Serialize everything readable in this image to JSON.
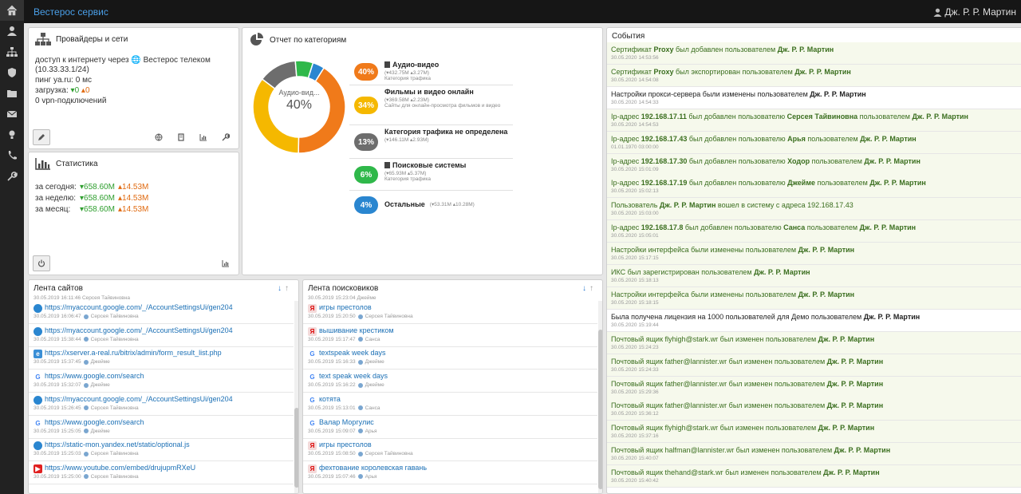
{
  "app": {
    "title": "Вестерос сервис",
    "user": "Дж. Р. Р. Мартин"
  },
  "sidebar": [
    {
      "icon": "home-icon",
      "active": true
    },
    {
      "icon": "user-icon"
    },
    {
      "icon": "sitemap-icon"
    },
    {
      "icon": "shield-icon"
    },
    {
      "icon": "folder-icon"
    },
    {
      "icon": "envelope-icon"
    },
    {
      "icon": "lightbulb-icon"
    },
    {
      "icon": "phone-icon"
    },
    {
      "icon": "wrench-icon"
    }
  ],
  "providers": {
    "title": "Провайдеры и сети",
    "access_prefix": "доступ к интернету через",
    "provider": "Вестерос телеком",
    "ip": "(10.33.33.1/24)",
    "ping": "пинг ya.ru: 0 мс",
    "load_label": "загрузка:",
    "load_down": "▾0",
    "load_up": "▴0",
    "vpn": "0 vpn-подключений"
  },
  "stats": {
    "title": "Статистика",
    "rows": [
      {
        "label": "за сегодня:",
        "down": "▾658.60M",
        "up": "▴14.53M"
      },
      {
        "label": "за неделю:",
        "down": "▾658.60M",
        "up": "▴14.53M"
      },
      {
        "label": "за месяц:",
        "down": "▾658.60M",
        "up": "▴14.53M"
      }
    ]
  },
  "categories": {
    "title": "Отчет по категориям",
    "donut_label": "Аудио-вид...",
    "donut_value": "40%",
    "items": [
      {
        "pct": "40%",
        "name": "Аудио-видео",
        "meta": "(▾432.75M ▴3.27M)",
        "sub": "Категория трафика",
        "color": "#f07a1a"
      },
      {
        "pct": "34%",
        "name": "Фильмы и видео онлайн",
        "meta": "(▾369.58M ▴2.23M)",
        "sub": "Сайты для онлайн-просмотра фильмов и видео",
        "color": "#f5b800"
      },
      {
        "pct": "13%",
        "name": "Категория трафика не определена",
        "meta": "(▾146.11M ▴2.93M)",
        "sub": "",
        "color": "#6d6d6d"
      },
      {
        "pct": "6%",
        "name": "Поисковые системы",
        "meta": "(▾65.93M ▴5.37M)",
        "sub": "Категория трафика",
        "color": "#2fb84a"
      },
      {
        "pct": "4%",
        "name": "Остальные",
        "meta": "(▾53.31M ▴10.28M)",
        "sub": "",
        "color": "#2a86d0"
      }
    ],
    "chart_data": {
      "type": "pie",
      "categories": [
        "Аудио-видео",
        "Фильмы и видео онлайн",
        "Категория трафика не определена",
        "Поисковые системы",
        "Остальные"
      ],
      "values": [
        40,
        34,
        13,
        6,
        4
      ],
      "colors": [
        "#f07a1a",
        "#f5b800",
        "#6d6d6d",
        "#2fb84a",
        "#2a86d0"
      ]
    }
  },
  "events": {
    "title": "События",
    "items": [
      {
        "t": [
          "Сертификат ",
          "Proxy",
          " был добавлен пользователем ",
          "Дж. Р. Р. Мартин"
        ],
        "d": "30.05.2020 14:53:56",
        "g": true
      },
      {
        "t": [
          "Сертификат ",
          "Proxy",
          " был экспортирован пользователем ",
          "Дж. Р. Р. Мартин"
        ],
        "d": "30.05.2020 14:54:08",
        "g": true
      },
      {
        "t": [
          "Настройки прокси-сервера были изменены пользователем ",
          "Дж. Р. Р. Мартин"
        ],
        "d": "30.05.2020 14:54:33",
        "g": false
      },
      {
        "t": [
          "Ip-адрес ",
          "192.168.17.11",
          " был добавлен пользователю ",
          "Серсея Тайвиновна",
          " пользователем ",
          "Дж. Р. Р. Мартин"
        ],
        "d": "30.05.2020 14:54:53",
        "g": true
      },
      {
        "t": [
          "Ip-адрес ",
          "192.168.17.43",
          " был добавлен пользователю ",
          "Арья",
          " пользователем ",
          "Дж. Р. Р. Мартин"
        ],
        "d": "01.01.1970 03:00:00",
        "g": true
      },
      {
        "t": [
          "Ip-адрес ",
          "192.168.17.30",
          " был добавлен пользователю ",
          "Ходор",
          " пользователем ",
          "Дж. Р. Р. Мартин"
        ],
        "d": "30.05.2020 15:01:09",
        "g": true
      },
      {
        "t": [
          "Ip-адрес ",
          "192.168.17.19",
          " был добавлен пользователю ",
          "Джейме",
          " пользователем ",
          "Дж. Р. Р. Мартин"
        ],
        "d": "30.05.2020 15:02:13",
        "g": true
      },
      {
        "t": [
          "Пользователь ",
          "Дж. Р. Р. Мартин",
          " вошел в систему с адреса 192.168.17.43"
        ],
        "d": "30.05.2020 15:03:00",
        "g": true
      },
      {
        "t": [
          "Ip-адрес ",
          "192.168.17.8",
          " был добавлен пользователю ",
          "Санса",
          " пользователем ",
          "Дж. Р. Р. Мартин"
        ],
        "d": "30.05.2020 15:05:01",
        "g": true
      },
      {
        "t": [
          "Настройки интерфейса были изменены пользователем ",
          "Дж. Р. Р. Мартин"
        ],
        "d": "30.05.2020 15:17:15",
        "g": true
      },
      {
        "t": [
          "ИКС был зарегистрирован пользователем ",
          "Дж. Р. Р. Мартин"
        ],
        "d": "30.05.2020 15:18:13",
        "g": true
      },
      {
        "t": [
          "Настройки интерфейса были изменены пользователем ",
          "Дж. Р. Р. Мартин"
        ],
        "d": "30.05.2020 15:18:15",
        "g": true
      },
      {
        "t": [
          "Была получена лицензия на 1000 пользователей для Демо пользователем ",
          "Дж. Р. Р. Мартин"
        ],
        "d": "30.05.2020 15:19:44",
        "g": false
      },
      {
        "t": [
          "Почтовый ящик flyhigh@stark.wr был изменен пользователем ",
          "Дж. Р. Р. Мартин"
        ],
        "d": "30.05.2020 15:24:23",
        "g": true
      },
      {
        "t": [
          "Почтовый ящик father@lannister.wr был изменен пользователем ",
          "Дж. Р. Р. Мартин"
        ],
        "d": "30.05.2020 15:24:33",
        "g": true
      },
      {
        "t": [
          "Почтовый ящик father@lannister.wr был изменен пользователем ",
          "Дж. Р. Р. Мартин"
        ],
        "d": "30.05.2020 15:29:36",
        "g": true
      },
      {
        "t": [
          "Почтовый ящик father@lannister.wr был изменен пользователем ",
          "Дж. Р. Р. Мартин"
        ],
        "d": "30.05.2020 15:36:12",
        "g": true
      },
      {
        "t": [
          "Почтовый ящик flyhigh@stark.wr был изменен пользователем ",
          "Дж. Р. Р. Мартин"
        ],
        "d": "30.05.2020 15:37:16",
        "g": true
      },
      {
        "t": [
          "Почтовый ящик halfman@lannister.wr был изменен пользователем ",
          "Дж. Р. Р. Мартин"
        ],
        "d": "30.05.2020 15:40:07",
        "g": true
      },
      {
        "t": [
          "Почтовый ящик thehand@stark.wr был изменен пользователем ",
          "Дж. Р. Р. Мартин"
        ],
        "d": "30.05.2020 15:40:42",
        "g": true
      }
    ]
  },
  "sites": {
    "title": "Лента сайтов",
    "top_meta": "30.05.2019 16:11:46",
    "top_user": "Серсея Тайвиновна",
    "items": [
      {
        "icon": "blue",
        "url": "https://myaccount.google.com/_/AccountSettingsUi/gen204",
        "d": "30.05.2019 16:06:47",
        "u": "Серсея Тайвиновна"
      },
      {
        "icon": "blue",
        "url": "https://myaccount.google.com/_/AccountSettingsUi/gen204",
        "d": "30.05.2019 15:38:44",
        "u": "Серсея Тайвиновна"
      },
      {
        "icon": "ie",
        "url": "https://xserver.a-real.ru/bitrix/admin/form_result_list.php",
        "d": "30.05.2019 15:37:45",
        "u": "Джейме"
      },
      {
        "icon": "google",
        "url": "https://www.google.com/search",
        "d": "30.05.2019 15:32:07",
        "u": "Джейме"
      },
      {
        "icon": "blue",
        "url": "https://myaccount.google.com/_/AccountSettingsUi/gen204",
        "d": "30.05.2019 15:26:45",
        "u": "Серсея Тайвиновна"
      },
      {
        "icon": "google",
        "url": "https://www.google.com/search",
        "d": "30.05.2019 15:25:05",
        "u": "Джейме"
      },
      {
        "icon": "blue",
        "url": "https://static-mon.yandex.net/static/optional.js",
        "d": "30.05.2019 15:25:03",
        "u": "Серсея Тайвиновна"
      },
      {
        "icon": "youtube",
        "url": "https://www.youtube.com/embed/drujupmRXeU",
        "d": "30.05.2019 15:25:00",
        "u": "Серсея Тайвиновна"
      }
    ]
  },
  "searches": {
    "title": "Лента поисковиков",
    "top_meta": "30.05.2019 15:23:04",
    "top_user": "Джейме",
    "items": [
      {
        "icon": "yandex",
        "q": "игры престолов",
        "d": "30.05.2019 15:20:50",
        "u": "Серсея Тайвиновна"
      },
      {
        "icon": "yandex",
        "q": "вышивание крестиком",
        "d": "30.05.2019 15:17:47",
        "u": "Санса"
      },
      {
        "icon": "google",
        "q": "textspeak week days",
        "d": "30.05.2019 15:16:33",
        "u": "Джейме"
      },
      {
        "icon": "google",
        "q": "text speak week days",
        "d": "30.05.2019 15:16:22",
        "u": "Джейме"
      },
      {
        "icon": "google",
        "q": "котята",
        "d": "30.05.2019 15:13:01",
        "u": "Санса"
      },
      {
        "icon": "google",
        "q": "Валар Моргулис",
        "d": "30.05.2019 15:09:07",
        "u": "Арья"
      },
      {
        "icon": "yandex",
        "q": "игры престолов",
        "d": "30.05.2019 15:08:50",
        "u": "Серсея Тайвиновна"
      },
      {
        "icon": "yandex",
        "q": "фехтование королевская гавань",
        "d": "30.05.2019 15:07:46",
        "u": "Арья"
      }
    ]
  },
  "colors": {
    "accent": "#4a9fe8",
    "green": "#2e9e2e",
    "orange": "#e06a10"
  }
}
